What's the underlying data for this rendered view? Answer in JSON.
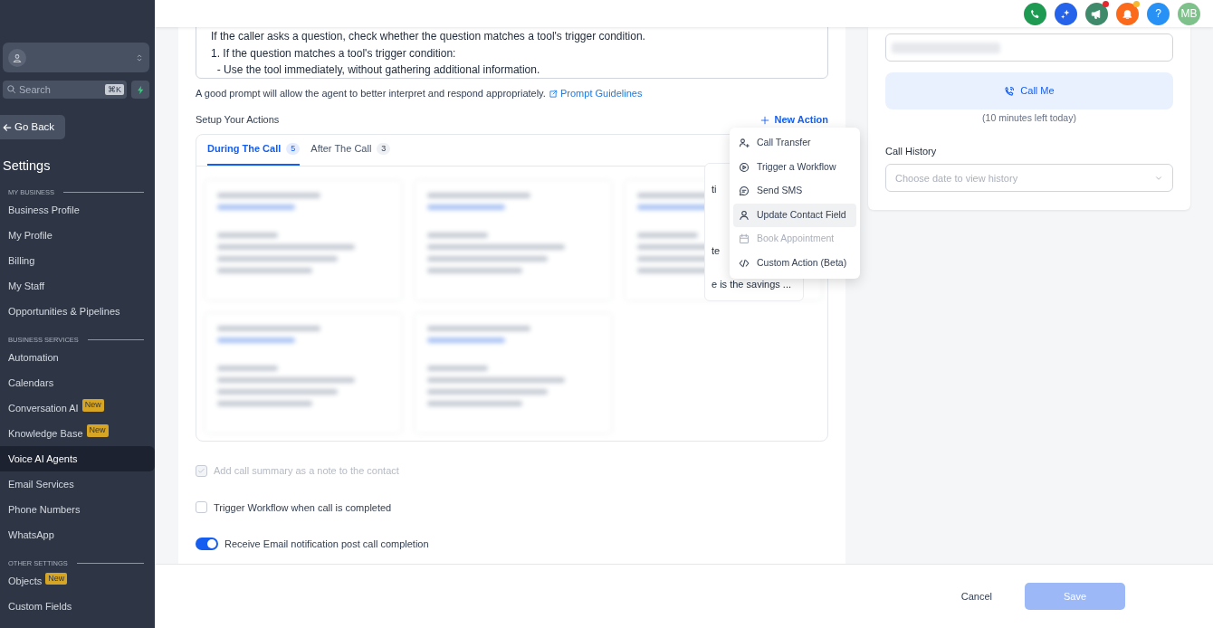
{
  "sidebar": {
    "search": {
      "placeholder": "Search",
      "shortcut": "⌘K"
    },
    "back_button": "Go Back",
    "title": "Settings",
    "sections": [
      {
        "heading": "MY BUSINESS",
        "items": [
          {
            "label": "Business Profile",
            "selected": false
          },
          {
            "label": "My Profile",
            "selected": false
          },
          {
            "label": "Billing",
            "selected": false
          },
          {
            "label": "My Staff",
            "selected": false
          },
          {
            "label": "Opportunities & Pipelines",
            "selected": false
          }
        ]
      },
      {
        "heading": "BUSINESS SERVICES",
        "items": [
          {
            "label": "Automation",
            "selected": false
          },
          {
            "label": "Calendars",
            "selected": false
          },
          {
            "label": "Conversation AI",
            "selected": false,
            "badge": "New"
          },
          {
            "label": "Knowledge Base",
            "selected": false,
            "badge": "New"
          },
          {
            "label": "Voice AI Agents",
            "selected": true
          },
          {
            "label": "Email Services",
            "selected": false
          },
          {
            "label": "Phone Numbers",
            "selected": false
          },
          {
            "label": "WhatsApp",
            "selected": false
          }
        ]
      },
      {
        "heading": "OTHER SETTINGS",
        "items": [
          {
            "label": "Objects",
            "selected": false,
            "badge": "New"
          },
          {
            "label": "Custom Fields",
            "selected": false
          }
        ]
      }
    ]
  },
  "topbar": {
    "icons": [
      {
        "kind": "phone",
        "color": "#1e9a52"
      },
      {
        "kind": "sparkle",
        "color": "#2563eb"
      },
      {
        "kind": "megaphone",
        "color": "#3f8a6b",
        "dot": {
          "color": "#e5262d"
        }
      },
      {
        "kind": "bell",
        "color": "#fb6a1a",
        "dot": {
          "color": "#f5b82e"
        }
      },
      {
        "kind": "help",
        "color": "#2891f5",
        "text": "?"
      },
      {
        "kind": "avatar",
        "color": "#7ec18a",
        "text": "MB"
      }
    ]
  },
  "prompt": {
    "lines": [
      "If the caller asks a question, check whether the question matches a tool's trigger condition.",
      "1. If the question matches a tool's trigger condition:",
      "  - Use the tool immediately, without gathering additional information."
    ],
    "hint": "A good prompt will allow the agent to better interpret and respond appropriately.",
    "link": "Prompt Guidelines"
  },
  "actions": {
    "title": "Setup Your Actions",
    "new_action": "New Action",
    "tabs": [
      {
        "label": "During The Call",
        "count": "5",
        "selected": true
      },
      {
        "label": "After The Call",
        "count": "3",
        "selected": false
      }
    ],
    "card_fragments": [
      "ti",
      "te",
      "e is the savings ..."
    ]
  },
  "menu": {
    "items": [
      {
        "label": "Call Transfer",
        "kind": "transfer",
        "highlighted": false,
        "disabled": false
      },
      {
        "label": "Trigger a Workflow",
        "kind": "workflow",
        "highlighted": false,
        "disabled": false
      },
      {
        "label": "Send SMS",
        "kind": "sms",
        "highlighted": false,
        "disabled": false
      },
      {
        "label": "Update Contact Field",
        "kind": "contact",
        "highlighted": true,
        "disabled": false
      },
      {
        "label": "Book Appointment",
        "kind": "calendar",
        "highlighted": false,
        "disabled": true
      },
      {
        "label": "Custom Action (Beta)",
        "kind": "code",
        "highlighted": false,
        "disabled": false
      }
    ]
  },
  "options": [
    {
      "kind": "checkbox",
      "label": "Add call summary as a note to the contact",
      "checked": true,
      "disabled": true
    },
    {
      "kind": "checkbox",
      "label": "Trigger Workflow when call is completed",
      "checked": false,
      "disabled": false
    },
    {
      "kind": "toggle",
      "label": "Receive Email notification post call completion",
      "on": true
    }
  ],
  "test_panel": {
    "call_button": "Call Me",
    "minutes_note": "(10 minutes left today)",
    "history_label": "Call History",
    "history_placeholder": "Choose date to view history"
  },
  "footer": {
    "cancel": "Cancel",
    "save": "Save",
    "save_disabled": true
  }
}
